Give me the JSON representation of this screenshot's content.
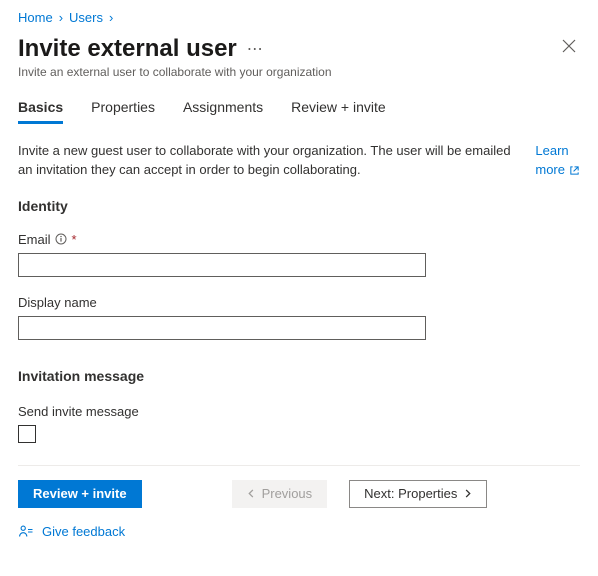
{
  "breadcrumb": {
    "items": [
      {
        "label": "Home"
      },
      {
        "label": "Users"
      }
    ]
  },
  "header": {
    "title": "Invite external user",
    "subtitle": "Invite an external user to collaborate with your organization"
  },
  "tabs": [
    {
      "label": "Basics",
      "active": true
    },
    {
      "label": "Properties"
    },
    {
      "label": "Assignments"
    },
    {
      "label": "Review + invite"
    }
  ],
  "intro": {
    "text": "Invite a new guest user to collaborate with your organization. The user will be emailed an invitation they can accept in order to begin collaborating.",
    "learn": "Learn",
    "more": "more"
  },
  "sections": {
    "identity_title": "Identity",
    "email_label": "Email",
    "email_value": "",
    "display_name_label": "Display name",
    "display_name_value": "",
    "invitation_title": "Invitation message",
    "send_invite_label": "Send invite message",
    "send_invite_checked": false
  },
  "footer": {
    "review_label": "Review + invite",
    "previous_label": "Previous",
    "next_label": "Next: Properties",
    "feedback_label": "Give feedback"
  }
}
